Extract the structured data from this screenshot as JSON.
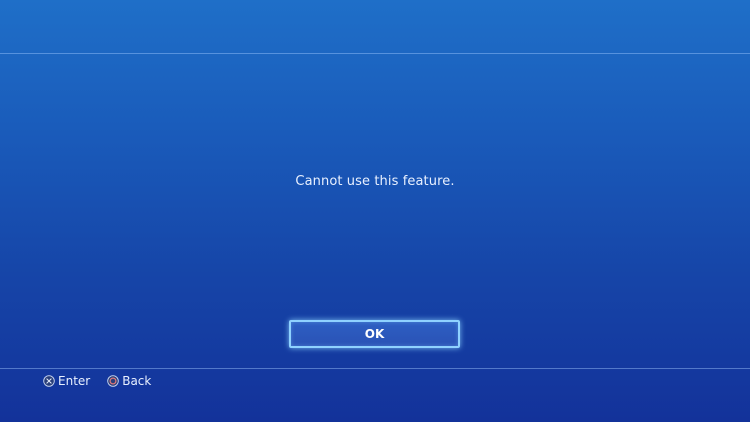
{
  "dialog": {
    "message": "Cannot use this feature.",
    "ok_label": "OK"
  },
  "footer": {
    "hints": [
      {
        "icon": "cross-button-icon",
        "label": "Enter"
      },
      {
        "icon": "circle-button-icon",
        "label": "Back"
      }
    ]
  },
  "colors": {
    "background_top": "#1f6fc8",
    "background_bottom": "#13329a",
    "focus_glow": "#8fd2ff"
  }
}
